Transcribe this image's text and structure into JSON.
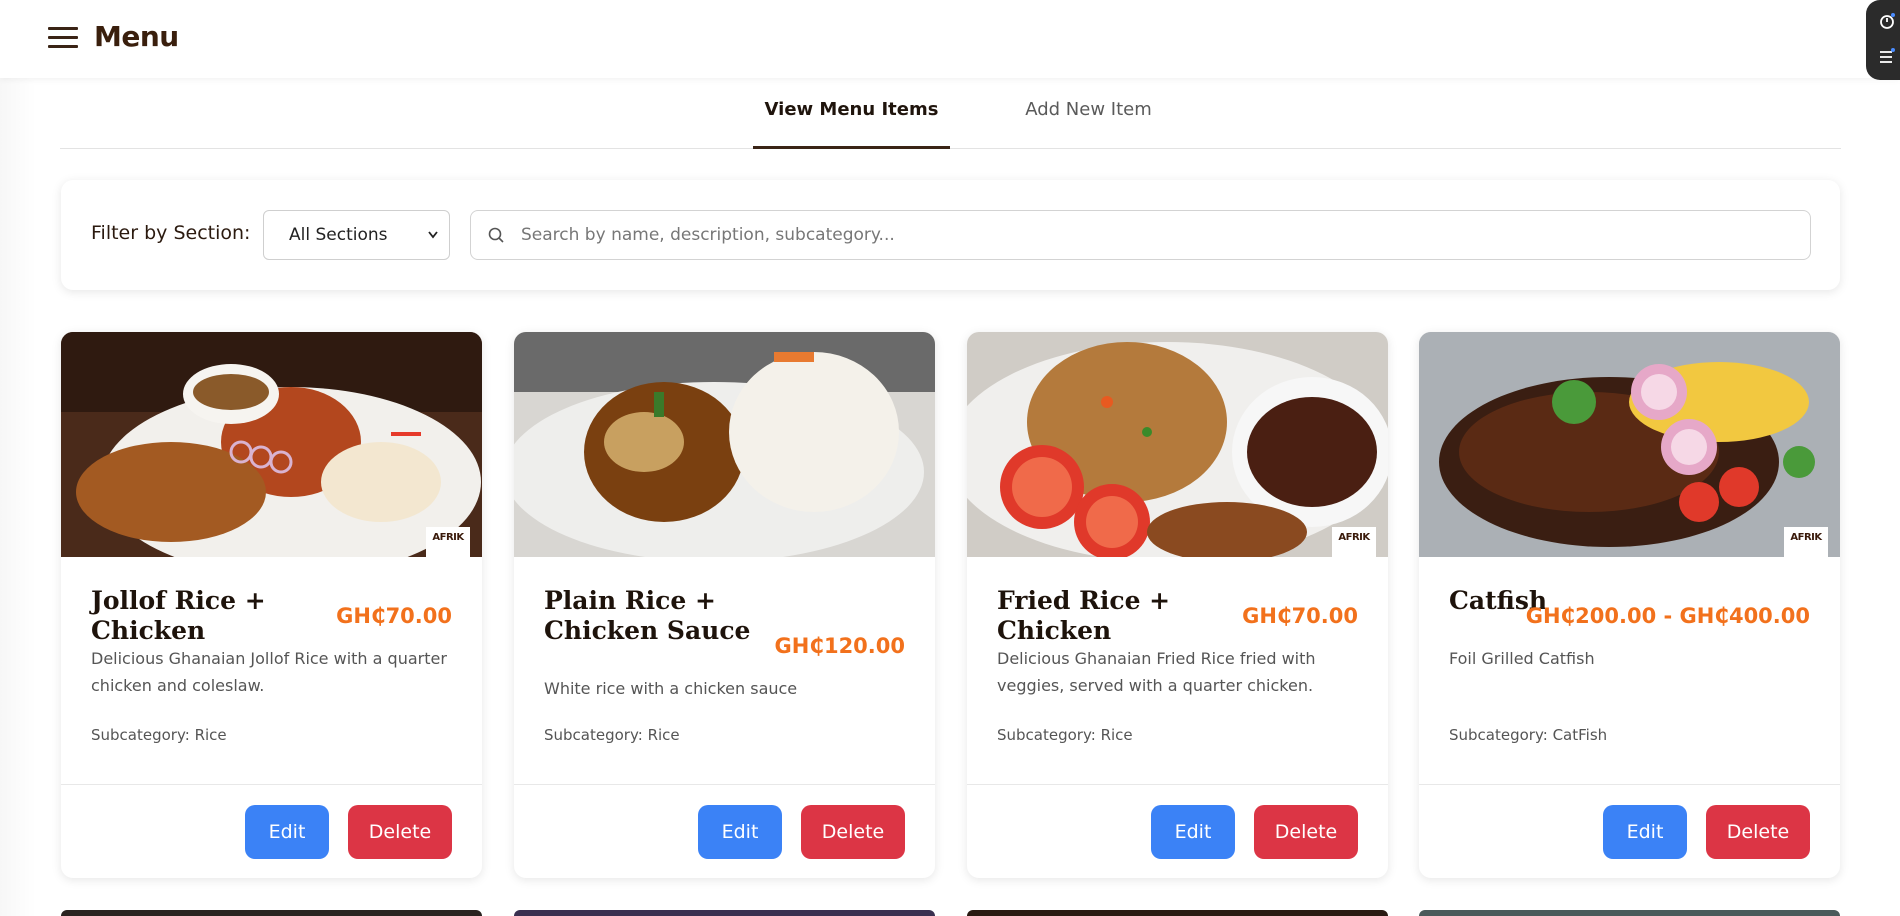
{
  "header": {
    "title": "Menu"
  },
  "tabs": [
    {
      "label": "View Menu Items",
      "active": true
    },
    {
      "label": "Add New Item",
      "active": false
    }
  ],
  "filter": {
    "label": "Filter by Section:",
    "select_value": "All Sections",
    "search_placeholder": "Search by name, description, subcategory..."
  },
  "colors": {
    "price": "#f2711c",
    "edit": "#3b82f6",
    "delete": "#dc3545",
    "brand": "#3a2416"
  },
  "cards": [
    {
      "title": "Jollof Rice + Chicken",
      "price": "GH₵70.00",
      "description": "Delicious Ghanaian Jollof Rice with a quarter chicken and coleslaw.",
      "subcategory": "Subcategory: Rice",
      "logo": "AFRIK",
      "edit_label": "Edit",
      "delete_label": "Delete"
    },
    {
      "title": "Plain Rice + Chicken Sauce",
      "price": "GH₵120.00",
      "description": "White rice with a chicken sauce",
      "subcategory": "Subcategory: Rice",
      "logo": "",
      "edit_label": "Edit",
      "delete_label": "Delete"
    },
    {
      "title": "Fried Rice + Chicken",
      "price": "GH₵70.00",
      "description": "Delicious Ghanaian Fried Rice fried with veggies, served with a quarter chicken.",
      "subcategory": "Subcategory: Rice",
      "logo": "AFRIK",
      "edit_label": "Edit",
      "delete_label": "Delete"
    },
    {
      "title": "Catfish",
      "price": "GH₵200.00 - GH₵400.00",
      "description": "Foil Grilled Catfish",
      "subcategory": "Subcategory: CatFish",
      "logo": "AFRIK",
      "edit_label": "Edit",
      "delete_label": "Delete"
    }
  ]
}
